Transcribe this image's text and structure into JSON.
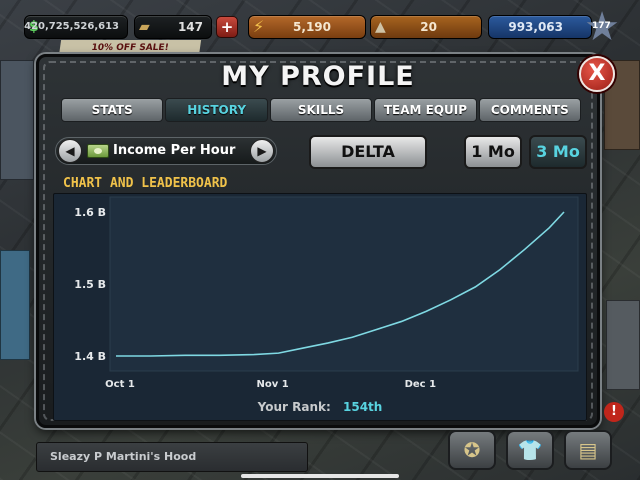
{
  "resources": {
    "cash": "420,725,526,613",
    "bricks": "147",
    "plus_label": "+",
    "energy": "5,190",
    "stamina": "20",
    "gold": "993,063",
    "level": "177"
  },
  "sale_banner": "10% OFF SALE!",
  "modal": {
    "title": "MY PROFILE",
    "close_label": "X",
    "tabs": [
      "STATS",
      "HISTORY",
      "SKILLS",
      "TEAM EQUIP",
      "COMMENTS"
    ],
    "active_tab": "HISTORY"
  },
  "controls": {
    "prev_label": "◀",
    "next_label": "▶",
    "metric": "Income Per Hour",
    "delta_label": "DELTA",
    "range_1mo": "1 Mo",
    "range_3mo": "3 Mo",
    "active_range": "3 Mo"
  },
  "section_label": "CHART AND LEADERBOARD",
  "chart_data": {
    "type": "line",
    "title": "",
    "xlabel": "",
    "ylabel": "",
    "x_ticks": [
      "Oct 1",
      "Nov 1",
      "Dec 1"
    ],
    "y_ticks": [
      "1.4 B",
      "1.5 B",
      "1.6 B"
    ],
    "ylim": [
      1.4,
      1.6
    ],
    "grid": false,
    "series": [
      {
        "color": "#7fd9e3",
        "x": [
          "2023-10-01",
          "2023-10-08",
          "2023-10-15",
          "2023-10-22",
          "2023-10-29",
          "2023-11-03",
          "2023-11-08",
          "2023-11-13",
          "2023-11-18",
          "2023-11-23",
          "2023-11-28",
          "2023-12-03",
          "2023-12-08",
          "2023-12-13",
          "2023-12-18",
          "2023-12-23",
          "2023-12-28",
          "2023-12-31"
        ],
        "values": [
          1.4,
          1.4,
          1.401,
          1.401,
          1.402,
          1.404,
          1.411,
          1.418,
          1.426,
          1.437,
          1.448,
          1.462,
          1.478,
          1.496,
          1.52,
          1.548,
          1.578,
          1.6
        ]
      }
    ]
  },
  "rank": {
    "label": "Your Rank:",
    "value": "154th"
  },
  "bottom": {
    "hood_name": "Sleazy P Martini's Hood"
  }
}
